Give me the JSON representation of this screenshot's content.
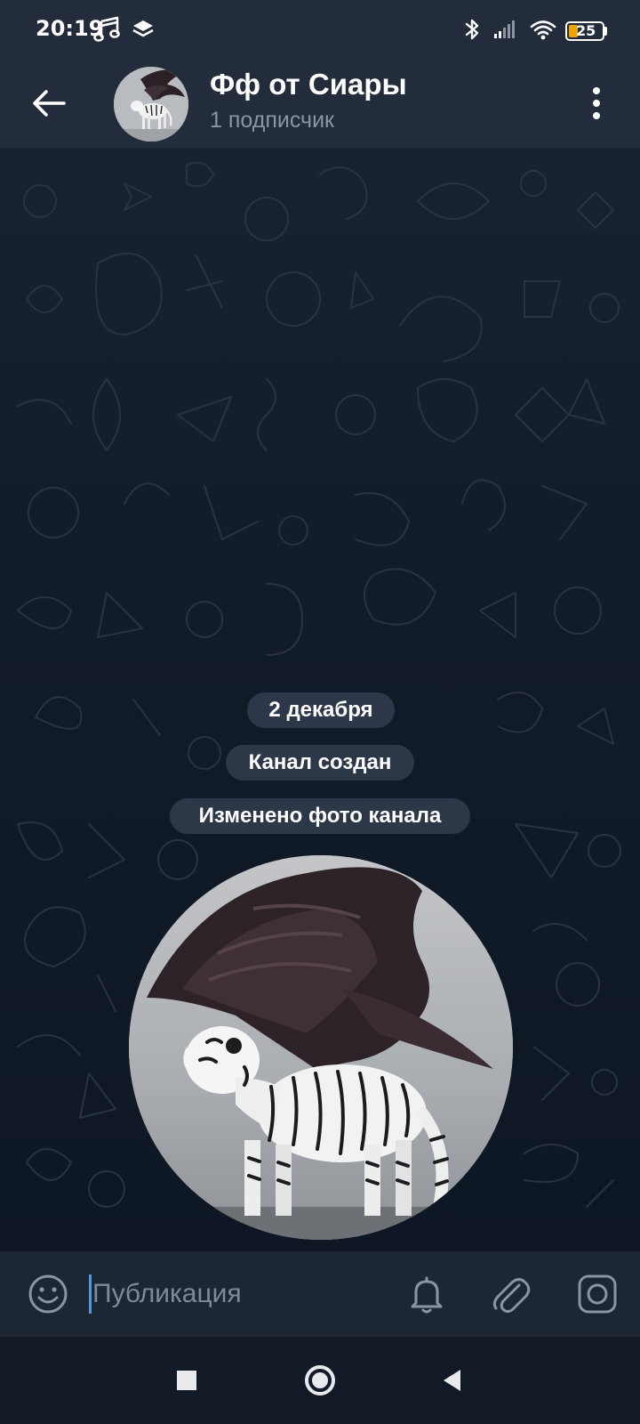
{
  "status_bar": {
    "time": "20:19",
    "battery_level": "25",
    "icons": [
      "music-note-icon",
      "layers-icon",
      "bluetooth-icon",
      "signal-icon",
      "wifi-icon",
      "battery-icon"
    ]
  },
  "header": {
    "title": "Фф от Сиары",
    "subtitle": "1 подписчик",
    "back_icon": "arrow-left-icon",
    "menu_icon": "more-vertical-icon"
  },
  "messages": {
    "date_label": "2 декабря",
    "service_created": "Канал создан",
    "service_photo_changed": "Изменено фото канала"
  },
  "input": {
    "placeholder": "Публикация",
    "value": "",
    "icons": [
      "emoji-icon",
      "bell-icon",
      "attach-icon",
      "camera-icon"
    ]
  },
  "navigation": {
    "icons": [
      "recents-square-icon",
      "home-circle-icon",
      "back-triangle-icon"
    ]
  },
  "colors": {
    "header_bg": "#232c3a",
    "chat_bg": "#121b29",
    "input_bg": "#1d2633",
    "accent_caret": "#4f9bd9",
    "subtitle_text": "#8a96a6",
    "battery_accent": "#f0a400"
  }
}
